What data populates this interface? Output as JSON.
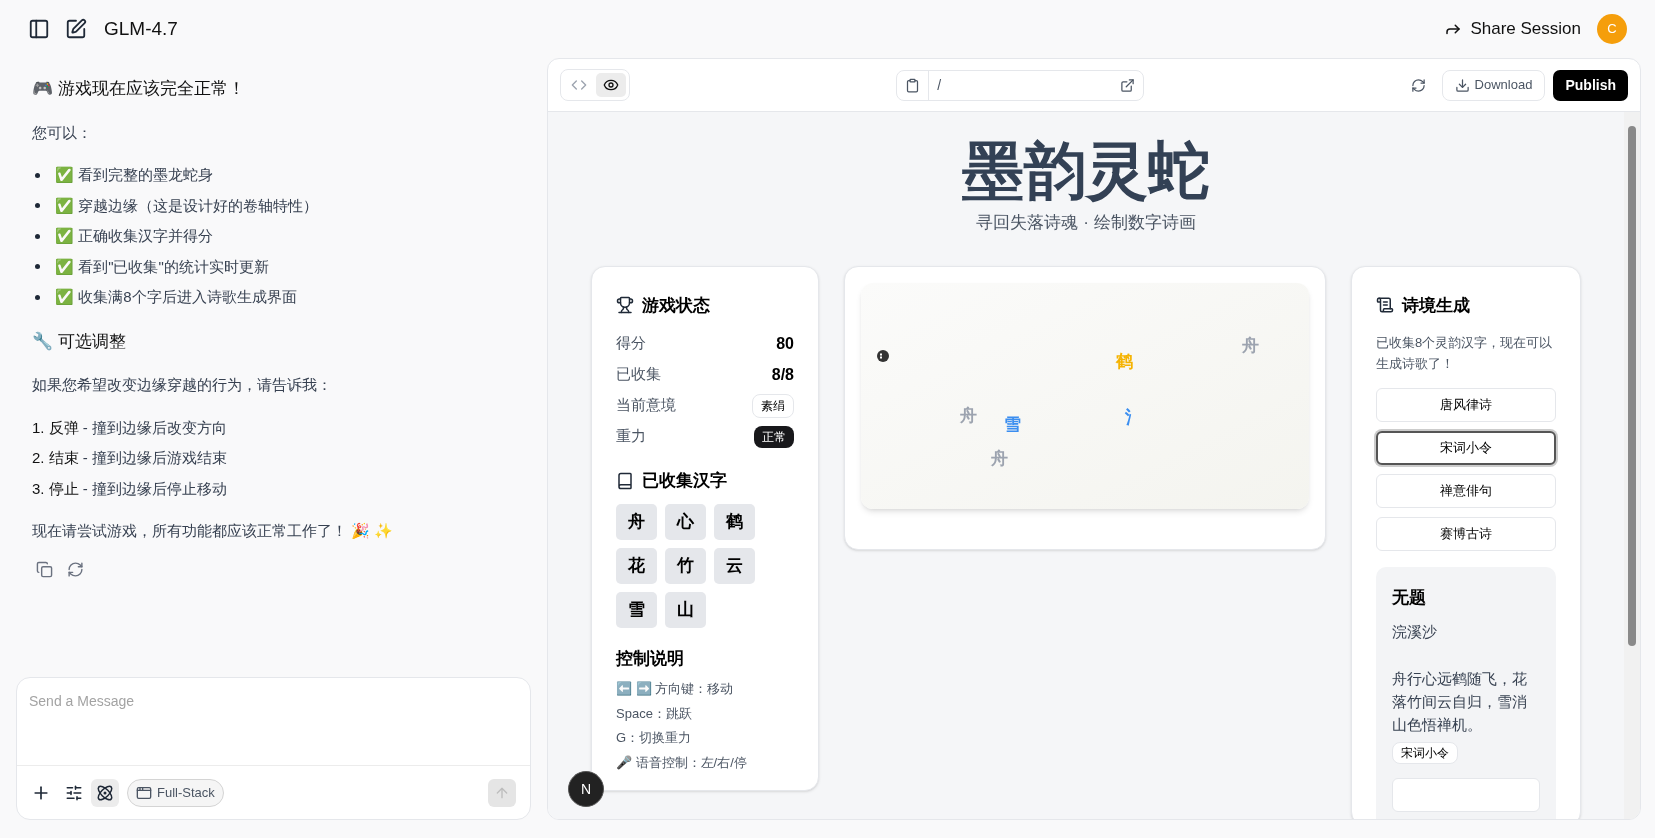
{
  "header": {
    "model": "GLM-4.7",
    "share_label": "Share Session",
    "avatar": "C"
  },
  "chat": {
    "heading": "🎮 游戏现在应该完全正常！",
    "intro": "您可以：",
    "checklist": [
      "✅ 看到完整的墨龙蛇身",
      "✅ 穿越边缘（这是设计好的卷轴特性）",
      "✅ 正确收集汉字并得分",
      "✅ 看到\"已收集\"的统计实时更新",
      "✅ 收集满8个字后进入诗歌生成界面"
    ],
    "subheading": "🔧 可选调整",
    "paragraph": "如果您希望改变边缘穿越的行为，请告诉我：",
    "options": [
      {
        "number": "1.",
        "term": "反弹",
        "text": " - 撞到边缘后改变方向"
      },
      {
        "number": "2.",
        "term": "结束",
        "text": " - 撞到边缘后游戏结束"
      },
      {
        "number": "3.",
        "term": "停止",
        "text": " - 撞到边缘后停止移动"
      }
    ],
    "closing": "现在请尝试游戏，所有功能都应该正常工作了！ 🎉 ✨"
  },
  "composer": {
    "placeholder": "Send a Message",
    "mode_chip": "Full-Stack",
    "atom_selected": true,
    "send_disabled": true
  },
  "preview": {
    "view_toggle": [
      {
        "kind": "code",
        "selected": false
      },
      {
        "kind": "preview",
        "selected": true
      }
    ],
    "url": "/",
    "download_label": "Download",
    "publish_label": "Publish",
    "fab": "N"
  },
  "game": {
    "title": "墨韵灵蛇",
    "subtitle": "寻回失落诗魂 · 绘制数字诗画",
    "status": {
      "title": "游戏状态",
      "rows": [
        {
          "label": "得分",
          "value": "80",
          "kind": "plain"
        },
        {
          "label": "已收集",
          "value": "8/8",
          "kind": "plain"
        },
        {
          "label": "当前意境",
          "value": "素绢",
          "kind": "outline"
        },
        {
          "label": "重力",
          "value": "正常",
          "kind": "filled"
        }
      ]
    },
    "collected": {
      "title": "已收集汉字",
      "chars": [
        "舟",
        "心",
        "鹤",
        "花",
        "竹",
        "云",
        "雪",
        "山"
      ]
    },
    "controls": {
      "title": "控制说明",
      "lines": [
        "⬅️ ➡️ 方向键：移动",
        "Space：跳跃",
        "G：切换重力",
        "🎤 语音控制：左/右/停"
      ]
    },
    "canvas_chars": [
      {
        "char": "鹤",
        "color": "#f5b301"
      },
      {
        "char": "舟",
        "color": "#9ca3af"
      },
      {
        "char": "舟",
        "color": "#9ca3af"
      },
      {
        "char": "雪",
        "color": "#3b8ef0"
      },
      {
        "char": "舟",
        "color": "#9ca3af"
      },
      {
        "char": "氵",
        "color": "#3b8ef0"
      }
    ],
    "poem_panel": {
      "title": "诗境生成",
      "note": "已收集8个灵韵汉字，现在可以生成诗歌了！",
      "styles": [
        {
          "label": "唐风律诗",
          "selected": false
        },
        {
          "label": "宋词小令",
          "selected": true
        },
        {
          "label": "禅意俳句",
          "selected": false
        },
        {
          "label": "赛博古诗",
          "selected": false
        }
      ],
      "poem": {
        "title": "无题",
        "form": "浣溪沙",
        "body": "舟行心远鹤随飞，花落竹间云自归，雪消山色悟禅机。",
        "tag": "宋词小令"
      }
    }
  }
}
